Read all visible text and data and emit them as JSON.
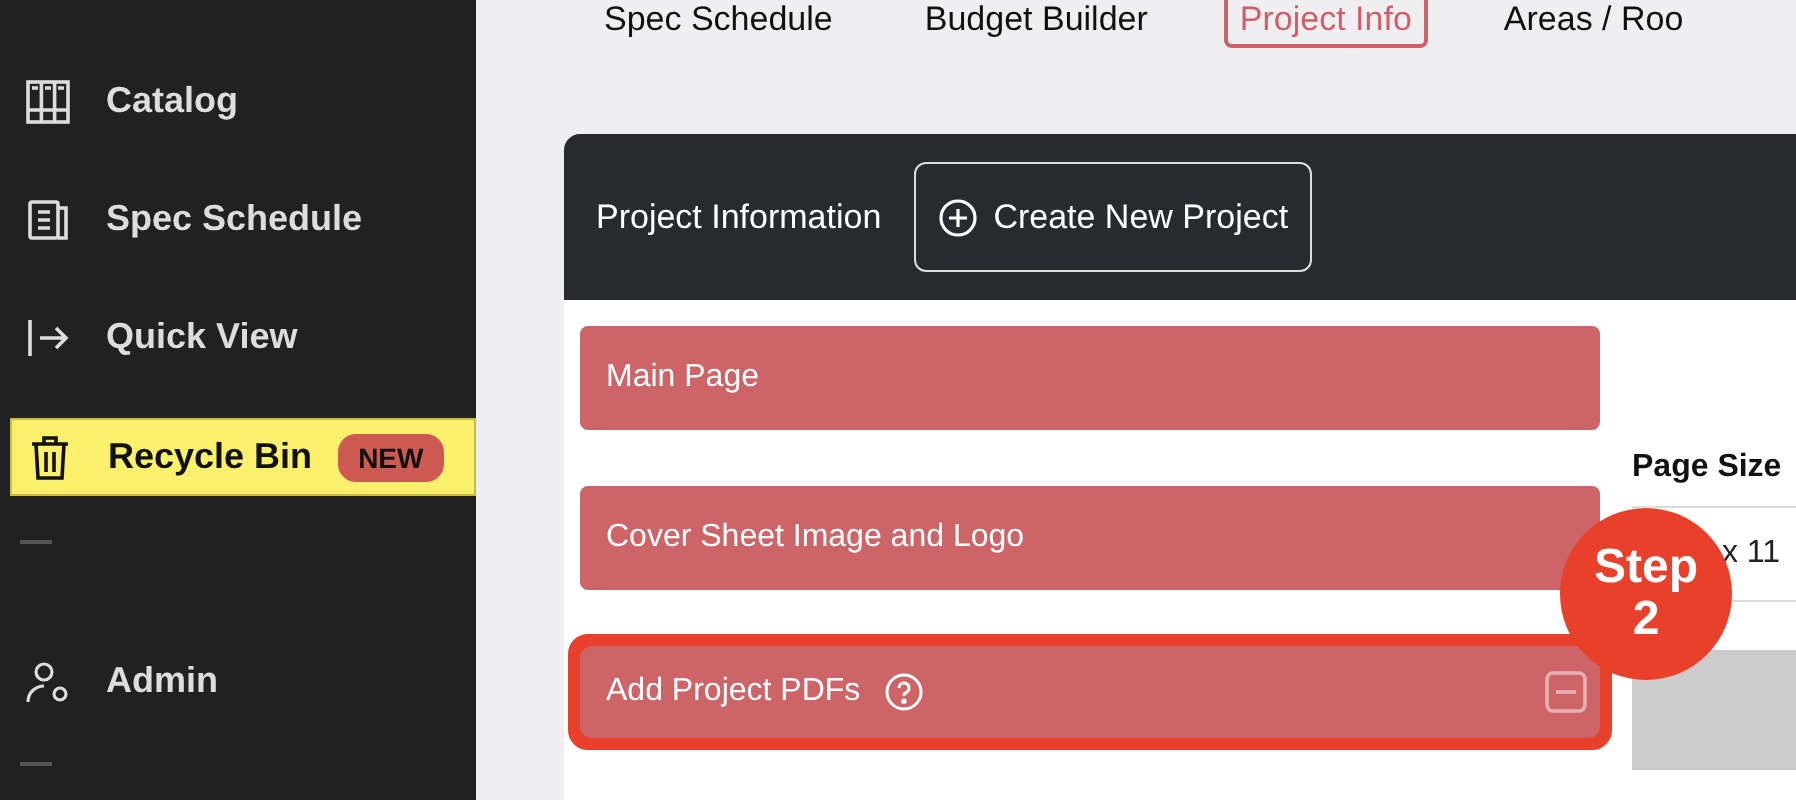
{
  "sidebar": {
    "items": [
      {
        "kind": "item",
        "label": "Catalog",
        "highlighted": false
      },
      {
        "kind": "item",
        "label": "Spec Schedule",
        "highlighted": false
      },
      {
        "kind": "item",
        "label": "Quick View",
        "highlighted": false
      },
      {
        "kind": "item",
        "label": "Recycle Bin",
        "highlighted": true,
        "badge": "NEW"
      },
      {
        "kind": "separator"
      },
      {
        "kind": "item",
        "label": "Admin",
        "highlighted": false
      },
      {
        "kind": "separator"
      }
    ]
  },
  "tabs": [
    {
      "label": "Spec Schedule",
      "selected": false
    },
    {
      "label": "Budget Builder",
      "selected": false
    },
    {
      "label": "Project Info",
      "selected": true
    },
    {
      "label": "Areas / Roo",
      "selected": false
    }
  ],
  "card": {
    "title": "Project Information",
    "create_button": "Create New Project",
    "sections": [
      {
        "label": "Main Page",
        "help": false,
        "collapsible": false,
        "highlighted": false
      },
      {
        "label": "Cover Sheet Image and Logo",
        "help": false,
        "collapsible": false,
        "highlighted": false
      },
      {
        "label": "Add Project PDFs",
        "help": true,
        "collapsible": true,
        "highlighted": true
      }
    ],
    "page_size": {
      "label": "Page Size",
      "value": "x 11"
    }
  },
  "callout": {
    "line_1": "Step",
    "line_2": "2"
  }
}
